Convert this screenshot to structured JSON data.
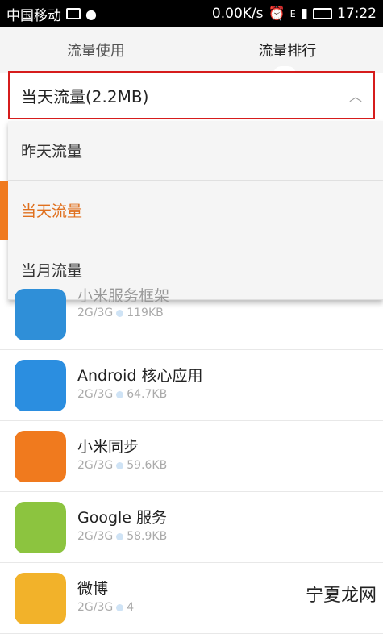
{
  "status": {
    "carrier": "中国移动",
    "speed": "0.00K/s",
    "signal": "E",
    "time": "17:22"
  },
  "tabs": [
    {
      "label": "流量使用"
    },
    {
      "label": "流量排行"
    }
  ],
  "dropdown": {
    "selected_label": "当天流量(2.2MB)",
    "options": [
      "昨天流量",
      "当天流量",
      "当月流量"
    ]
  },
  "apps": [
    {
      "name": "小米服务框架",
      "network": "2G/3G",
      "usage": "119KB",
      "icon": "mi-framework-icon",
      "color": "#2f8fd8"
    },
    {
      "name": "Android 核心应用",
      "network": "2G/3G",
      "usage": "64.7KB",
      "icon": "user-icon",
      "color": "#2b8ee0"
    },
    {
      "name": "小米同步",
      "network": "2G/3G",
      "usage": "59.6KB",
      "icon": "mi-sync-icon",
      "color": "#f07a1e"
    },
    {
      "name": "Google 服务",
      "network": "2G/3G",
      "usage": "58.9KB",
      "icon": "android-icon",
      "color": "#8cc43f"
    },
    {
      "name": "微博",
      "network": "2G/3G",
      "usage": "4",
      "icon": "weibo-icon",
      "color": "#f2b22a"
    }
  ],
  "watermark": "宁夏龙网"
}
